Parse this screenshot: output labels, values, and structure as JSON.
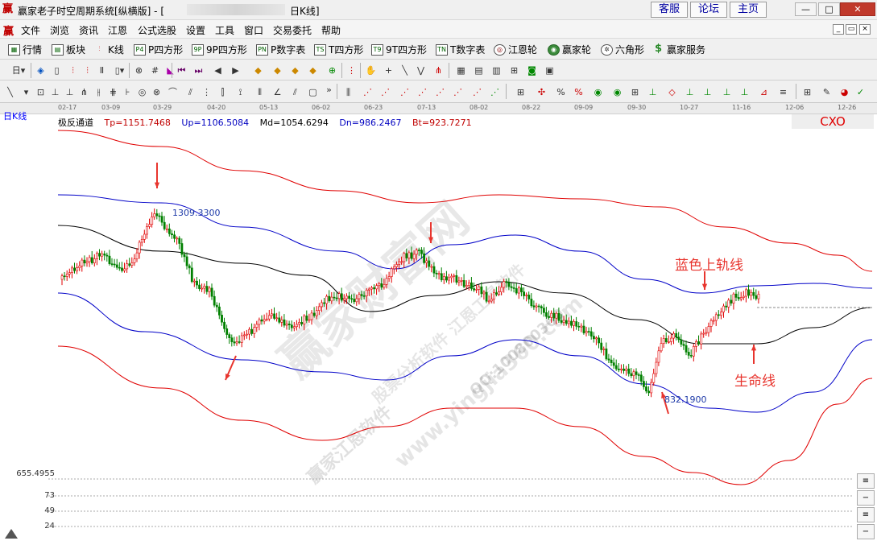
{
  "window": {
    "logo_glyph": "赢",
    "title_prefix": "赢家老子时空周期系统[纵横版] - [",
    "title_suffix": "日K线]",
    "links": [
      "客服",
      "论坛",
      "主页"
    ],
    "controls": [
      "—",
      "□",
      "✕"
    ]
  },
  "menu": {
    "items": [
      "文件",
      "浏览",
      "资讯",
      "江恩",
      "公式选股",
      "设置",
      "工具",
      "窗口",
      "交易委托",
      "帮助"
    ],
    "mdi_controls": [
      "_",
      "▭",
      "×"
    ]
  },
  "toolbar1": {
    "items": [
      {
        "label": "行情",
        "icon": "grid-icon"
      },
      {
        "label": "板块",
        "icon": "block-icon"
      },
      {
        "label": "K线",
        "icon": "kline-icon"
      },
      {
        "label": "P四方形",
        "icon": "P4"
      },
      {
        "label": "9P四方形",
        "icon": "9P"
      },
      {
        "label": "P数字表",
        "icon": "PN"
      },
      {
        "label": "T四方形",
        "icon": "TS"
      },
      {
        "label": "9T四方形",
        "icon": "T9"
      },
      {
        "label": "T数字表",
        "icon": "TN"
      },
      {
        "label": "江恩轮",
        "icon": "gann-wheel-icon"
      },
      {
        "label": "赢家轮",
        "icon": "winner-wheel-icon"
      },
      {
        "label": "六角形",
        "icon": "hexagon-icon"
      },
      {
        "label": "赢家服务",
        "icon": "dollar-icon"
      }
    ]
  },
  "chart": {
    "period_label": "日K线",
    "symbol": "CXO",
    "dates": [
      "02-17",
      "03-09",
      "03-29",
      "04-20",
      "05-13",
      "06-02",
      "06-23",
      "07-13",
      "08-02",
      "08-22",
      "09-09",
      "09-30",
      "10-27",
      "11-16",
      "12-06",
      "12-26"
    ],
    "indicator": {
      "name": "极反通道",
      "tp": "Tp=1151.7468",
      "up": "Up=1106.5084",
      "md": "Md=1054.6294",
      "dn": "Dn=986.2467",
      "bt": "Bt=923.7271"
    },
    "high_price": "1309.3300",
    "low_price": "832.1900",
    "annotations": {
      "upper_rail": "蓝色上轨线",
      "life_line": "生命线"
    },
    "watermarks": [
      "赢家财富网",
      "赢家江恩软件",
      "股票分析软件 江恩工具软件",
      "www.yingjia360.com",
      "QQ:100800360"
    ],
    "volume_axis": [
      "655.4955",
      "73",
      "49",
      "24"
    ],
    "colors": {
      "candle_up": "#e00000",
      "candle_down": "#008000",
      "outer_band": "#e00000",
      "inner_band": "#0000c8",
      "mid_line": "#000000",
      "annotation": "#e8352e"
    }
  }
}
